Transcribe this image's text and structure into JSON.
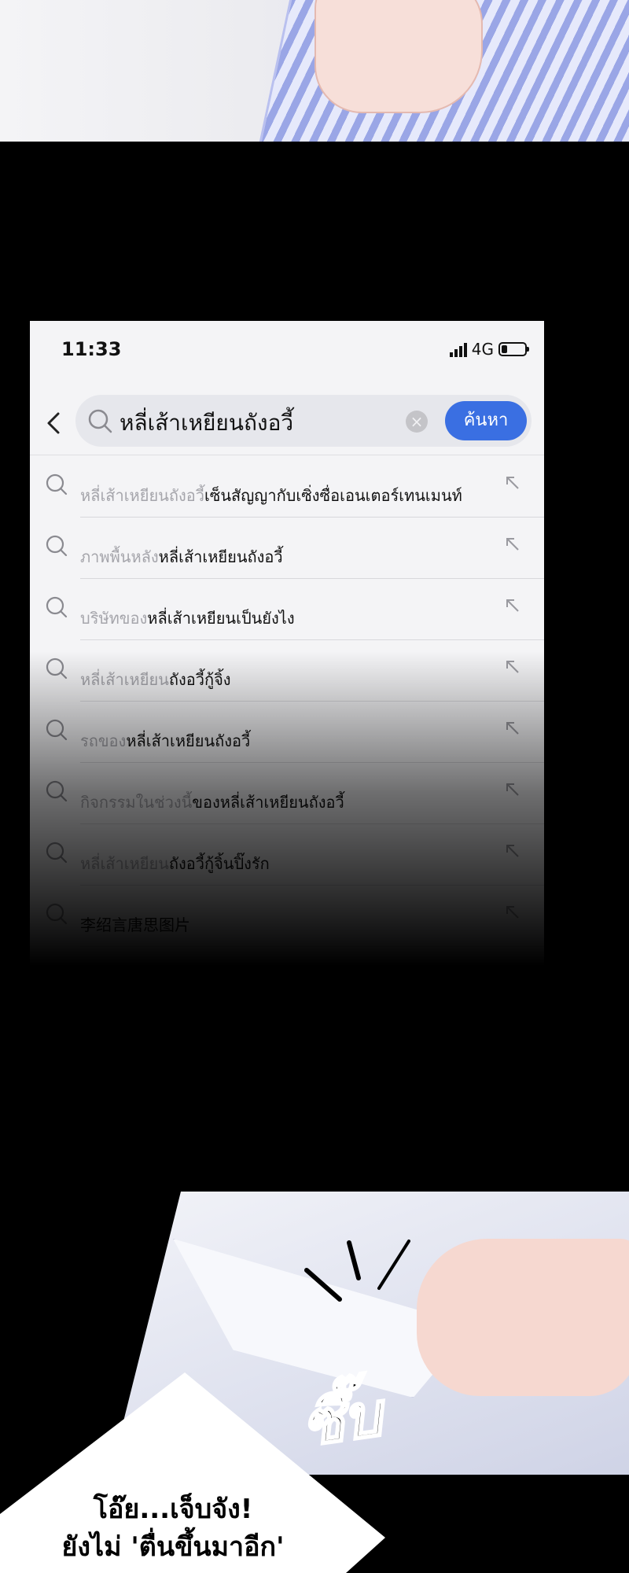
{
  "status_bar": {
    "time": "11:33",
    "network": "4G",
    "battery_level": 0.25
  },
  "search": {
    "query": "หลี่เส้าเหยียนถังอวี้",
    "clear_icon": "clear-circle-icon",
    "submit_label": "ค้นหา",
    "accent_color": "#3a6fe2"
  },
  "suggestions": [
    {
      "muted": "หลี่เส้าเหยียนถังอวี้",
      "text": "เซ็นสัญญากับเซิ่งซื่อเอนเตอร์เทนเมนท์"
    },
    {
      "muted": "ภาพพื้นหลัง",
      "text": "หลี่เส้าเหยียนถังอวี้"
    },
    {
      "muted": "บริษัทของ",
      "text": "หลี่เส้าเหยียนเป็นยังไง"
    },
    {
      "muted": "หลี่เส้าเหยียน",
      "text": "ถังอวี้กู้จิ้ง"
    },
    {
      "muted": "รถของ",
      "text": "หลี่เส้าเหยียนถังอวี้"
    },
    {
      "muted": "กิจกรรมในช่วงนี้",
      "text": "ของหลี่เส้าเหยียนถังอวี้"
    },
    {
      "muted": "หลี่เส้าเหยียน",
      "text": "ถังอวี้กู้จิ้นปิ๊งรัก"
    },
    {
      "muted": "",
      "text": "李绍言唐思图片"
    }
  ],
  "comic": {
    "sound_effect": "ซึ๊บ",
    "speech_line1": "โอ๊ย...เจ็บจัง!",
    "speech_line2": "ยังไม่ 'ตื่นขึ้นมาอีก'"
  }
}
